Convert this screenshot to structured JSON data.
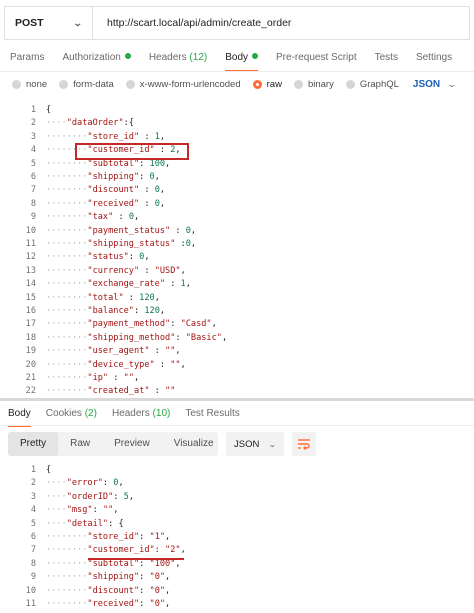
{
  "request": {
    "method": "POST",
    "url": "http://scart.local/api/admin/create_order"
  },
  "request_tabs": [
    {
      "label": "Params",
      "count": "",
      "dot": false,
      "active": false
    },
    {
      "label": "Authorization",
      "count": "",
      "dot": true,
      "active": false
    },
    {
      "label": "Headers",
      "count": "(12)",
      "dot": false,
      "active": false
    },
    {
      "label": "Body",
      "count": "",
      "dot": true,
      "active": true
    },
    {
      "label": "Pre-request Script",
      "count": "",
      "dot": false,
      "active": false
    },
    {
      "label": "Tests",
      "count": "",
      "dot": false,
      "active": false
    },
    {
      "label": "Settings",
      "count": "",
      "dot": false,
      "active": false
    }
  ],
  "body_types": [
    {
      "label": "none",
      "selected": false
    },
    {
      "label": "form-data",
      "selected": false
    },
    {
      "label": "x-www-form-urlencoded",
      "selected": false
    },
    {
      "label": "raw",
      "selected": true
    },
    {
      "label": "binary",
      "selected": false
    },
    {
      "label": "GraphQL",
      "selected": false
    }
  ],
  "raw_format": "JSON",
  "request_body": [
    {
      "n": "1",
      "indent": 0,
      "parts": [
        [
          "p",
          "{"
        ]
      ]
    },
    {
      "n": "2",
      "indent": 1,
      "parts": [
        [
          "k",
          "\"dataOrder\""
        ],
        [
          "p",
          ":{"
        ]
      ]
    },
    {
      "n": "3",
      "indent": 2,
      "parts": [
        [
          "k",
          "\"store_id\""
        ],
        [
          "p",
          " : "
        ],
        [
          "n",
          "1"
        ],
        [
          "p",
          ","
        ]
      ]
    },
    {
      "n": "4",
      "indent": 2,
      "parts": [
        [
          "k",
          "\"customer_id\""
        ],
        [
          "p",
          " : "
        ],
        [
          "n",
          "2"
        ],
        [
          "p",
          ","
        ]
      ]
    },
    {
      "n": "5",
      "indent": 2,
      "parts": [
        [
          "k",
          "\"subtotal\""
        ],
        [
          "p",
          ": "
        ],
        [
          "n",
          "100"
        ],
        [
          "p",
          ","
        ]
      ]
    },
    {
      "n": "6",
      "indent": 2,
      "parts": [
        [
          "k",
          "\"shipping\""
        ],
        [
          "p",
          ": "
        ],
        [
          "n",
          "0"
        ],
        [
          "p",
          ","
        ]
      ]
    },
    {
      "n": "7",
      "indent": 2,
      "parts": [
        [
          "k",
          "\"discount\""
        ],
        [
          "p",
          " : "
        ],
        [
          "n",
          "0"
        ],
        [
          "p",
          ","
        ]
      ]
    },
    {
      "n": "8",
      "indent": 2,
      "parts": [
        [
          "k",
          "\"received\""
        ],
        [
          "p",
          " : "
        ],
        [
          "n",
          "0"
        ],
        [
          "p",
          ","
        ]
      ]
    },
    {
      "n": "9",
      "indent": 2,
      "parts": [
        [
          "k",
          "\"tax\""
        ],
        [
          "p",
          " : "
        ],
        [
          "n",
          "0"
        ],
        [
          "p",
          ","
        ]
      ]
    },
    {
      "n": "10",
      "indent": 2,
      "parts": [
        [
          "k",
          "\"payment_status\""
        ],
        [
          "p",
          " : "
        ],
        [
          "n",
          "0"
        ],
        [
          "p",
          ","
        ]
      ]
    },
    {
      "n": "11",
      "indent": 2,
      "parts": [
        [
          "k",
          "\"shipping_status\""
        ],
        [
          "p",
          " :"
        ],
        [
          "n",
          "0"
        ],
        [
          "p",
          ","
        ]
      ]
    },
    {
      "n": "12",
      "indent": 2,
      "parts": [
        [
          "k",
          "\"status\""
        ],
        [
          "p",
          ": "
        ],
        [
          "n",
          "0"
        ],
        [
          "p",
          ","
        ]
      ]
    },
    {
      "n": "13",
      "indent": 2,
      "parts": [
        [
          "k",
          "\"currency\""
        ],
        [
          "p",
          " : "
        ],
        [
          "s",
          "\"USD\""
        ],
        [
          "p",
          ","
        ]
      ]
    },
    {
      "n": "14",
      "indent": 2,
      "parts": [
        [
          "k",
          "\"exchange_rate\""
        ],
        [
          "p",
          " : "
        ],
        [
          "n",
          "1"
        ],
        [
          "p",
          ","
        ]
      ]
    },
    {
      "n": "15",
      "indent": 2,
      "parts": [
        [
          "k",
          "\"total\""
        ],
        [
          "p",
          " : "
        ],
        [
          "n",
          "120"
        ],
        [
          "p",
          ","
        ]
      ]
    },
    {
      "n": "16",
      "indent": 2,
      "parts": [
        [
          "k",
          "\"balance\""
        ],
        [
          "p",
          ": "
        ],
        [
          "n",
          "120"
        ],
        [
          "p",
          ","
        ]
      ]
    },
    {
      "n": "17",
      "indent": 2,
      "parts": [
        [
          "k",
          "\"payment_method\""
        ],
        [
          "p",
          ": "
        ],
        [
          "s",
          "\"Casd\""
        ],
        [
          "p",
          ","
        ]
      ]
    },
    {
      "n": "18",
      "indent": 2,
      "parts": [
        [
          "k",
          "\"shipping_method\""
        ],
        [
          "p",
          ": "
        ],
        [
          "s",
          "\"Basic\""
        ],
        [
          "p",
          ","
        ]
      ]
    },
    {
      "n": "19",
      "indent": 2,
      "parts": [
        [
          "k",
          "\"user_agent\""
        ],
        [
          "p",
          " : "
        ],
        [
          "s",
          "\"\""
        ],
        [
          "p",
          ","
        ]
      ]
    },
    {
      "n": "20",
      "indent": 2,
      "parts": [
        [
          "k",
          "\"device_type\""
        ],
        [
          "p",
          " : "
        ],
        [
          "s",
          "\"\""
        ],
        [
          "p",
          ","
        ]
      ]
    },
    {
      "n": "21",
      "indent": 2,
      "parts": [
        [
          "k",
          "\"ip\""
        ],
        [
          "p",
          " : "
        ],
        [
          "s",
          "\"\""
        ],
        [
          "p",
          ","
        ]
      ]
    },
    {
      "n": "22",
      "indent": 2,
      "parts": [
        [
          "k",
          "\"created_at\""
        ],
        [
          "p",
          " : "
        ],
        [
          "s",
          "\"\""
        ]
      ]
    }
  ],
  "response_tabs": [
    {
      "label": "Body",
      "count": "",
      "active": true
    },
    {
      "label": "Cookies",
      "count": "(2)",
      "active": false
    },
    {
      "label": "Headers",
      "count": "(10)",
      "active": false
    },
    {
      "label": "Test Results",
      "count": "",
      "active": false
    }
  ],
  "view_modes": [
    {
      "label": "Pretty",
      "active": true
    },
    {
      "label": "Raw",
      "active": false
    },
    {
      "label": "Preview",
      "active": false
    },
    {
      "label": "Visualize",
      "active": false
    }
  ],
  "response_format": "JSON",
  "response_body": [
    {
      "n": "1",
      "indent": 0,
      "parts": [
        [
          "p",
          "{"
        ]
      ]
    },
    {
      "n": "2",
      "indent": 1,
      "parts": [
        [
          "k",
          "\"error\""
        ],
        [
          "p",
          ": "
        ],
        [
          "n",
          "0"
        ],
        [
          "p",
          ","
        ]
      ]
    },
    {
      "n": "3",
      "indent": 1,
      "parts": [
        [
          "k",
          "\"orderID\""
        ],
        [
          "p",
          ": "
        ],
        [
          "n",
          "5"
        ],
        [
          "p",
          ","
        ]
      ]
    },
    {
      "n": "4",
      "indent": 1,
      "parts": [
        [
          "k",
          "\"msg\""
        ],
        [
          "p",
          ": "
        ],
        [
          "s",
          "\"\""
        ],
        [
          "p",
          ","
        ]
      ]
    },
    {
      "n": "5",
      "indent": 1,
      "parts": [
        [
          "k",
          "\"detail\""
        ],
        [
          "p",
          ": {"
        ]
      ]
    },
    {
      "n": "6",
      "indent": 2,
      "parts": [
        [
          "k",
          "\"store_id\""
        ],
        [
          "p",
          ": "
        ],
        [
          "s",
          "\"1\""
        ],
        [
          "p",
          ","
        ]
      ]
    },
    {
      "n": "7",
      "indent": 2,
      "parts": [
        [
          "k",
          "\"customer_id\""
        ],
        [
          "p",
          ": "
        ],
        [
          "s",
          "\"2\""
        ],
        [
          "p",
          ","
        ]
      ]
    },
    {
      "n": "8",
      "indent": 2,
      "parts": [
        [
          "k",
          "\"subtotal\""
        ],
        [
          "p",
          ": "
        ],
        [
          "s",
          "\"100\""
        ],
        [
          "p",
          ","
        ]
      ]
    },
    {
      "n": "9",
      "indent": 2,
      "parts": [
        [
          "k",
          "\"shipping\""
        ],
        [
          "p",
          ": "
        ],
        [
          "s",
          "\"0\""
        ],
        [
          "p",
          ","
        ]
      ]
    },
    {
      "n": "10",
      "indent": 2,
      "parts": [
        [
          "k",
          "\"discount\""
        ],
        [
          "p",
          ": "
        ],
        [
          "s",
          "\"0\""
        ],
        [
          "p",
          ","
        ]
      ]
    },
    {
      "n": "11",
      "indent": 2,
      "parts": [
        [
          "k",
          "\"received\""
        ],
        [
          "p",
          ": "
        ],
        [
          "s",
          "\"0\""
        ],
        [
          "p",
          ","
        ]
      ]
    }
  ],
  "colors": {
    "accent": "#ff6c37",
    "success": "#28a745",
    "highlight": "#c62828",
    "json_link": "#1a5fb4"
  }
}
